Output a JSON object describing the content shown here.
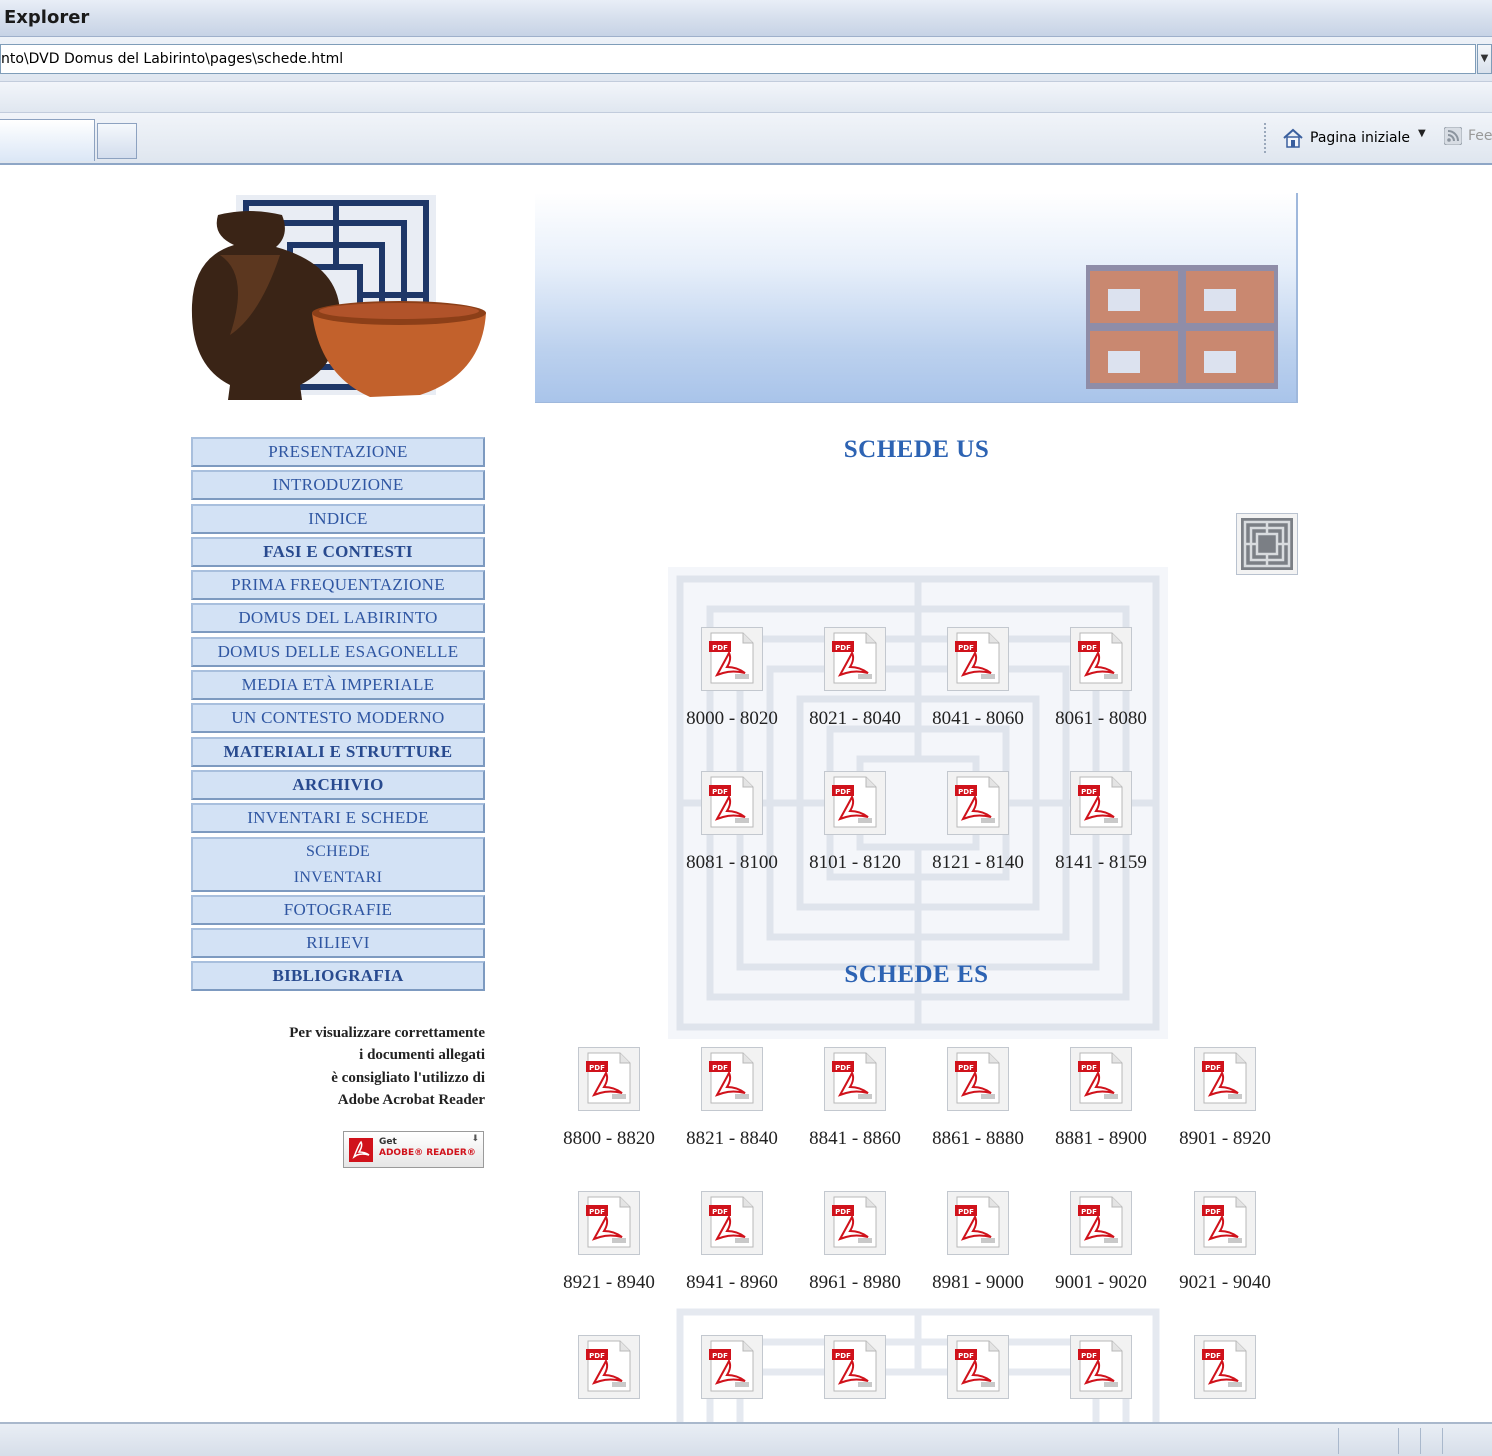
{
  "browser": {
    "title": "Explorer",
    "address": "nto\\DVD Domus del Labirinto\\pages\\schede.html",
    "home_label": "Pagina iniziale",
    "feed_label": "Fee"
  },
  "menu": [
    {
      "label": "PRESENTAZIONE",
      "style": "normal"
    },
    {
      "label": "INTRODUZIONE",
      "style": "normal"
    },
    {
      "label": "INDICE",
      "style": "normal"
    },
    {
      "label": "FASI E CONTESTI",
      "style": "bold"
    },
    {
      "label": "PRIMA FREQUENTAZIONE",
      "style": "normal"
    },
    {
      "label": "DOMUS DEL LABIRINTO",
      "style": "normal"
    },
    {
      "label": "DOMUS DELLE ESAGONELLE",
      "style": "normal"
    },
    {
      "label": "MEDIA ETÀ IMPERIALE",
      "style": "normal"
    },
    {
      "label": "UN CONTESTO MODERNO",
      "style": "normal"
    },
    {
      "label": "MATERIALI E STRUTTURE",
      "style": "bold"
    },
    {
      "label": "ARCHIVIO",
      "style": "bold"
    },
    {
      "label": "INVENTARI E SCHEDE",
      "style": "normal"
    },
    {
      "label": "SCHEDE\nINVENTARI",
      "style": "tall"
    },
    {
      "label": "FOTOGRAFIE",
      "style": "normal"
    },
    {
      "label": "RILIEVI",
      "style": "normal"
    },
    {
      "label": "BIBLIOGRAFIA",
      "style": "bold"
    }
  ],
  "note": {
    "line1": "Per visualizzare correttamente",
    "line2": "i documenti allegati",
    "line3": "è consigliato l'utilizzo di",
    "line4": "Adobe Acrobat Reader"
  },
  "adobe_badge": {
    "get": "Get",
    "text": "ADOBE® READER®"
  },
  "sections": {
    "us_title": "SCHEDE US",
    "es_title": "SCHEDE ES"
  },
  "us_files": [
    "8000 - 8020",
    "8021 - 8040",
    "8041 - 8060",
    "8061 - 8080",
    "8081 - 8100",
    "8101 - 8120",
    "8121 - 8140",
    "8141 - 8159"
  ],
  "es_files": [
    "8800 - 8820",
    "8821 - 8840",
    "8841 - 8860",
    "8861 - 8880",
    "8881 - 8900",
    "8901 - 8920",
    "8921 - 8940",
    "8941 - 8960",
    "8961 - 8980",
    "8981 - 9000",
    "9001 - 9020",
    "9021 - 9040"
  ],
  "es_files_partial_count": 6,
  "icons": {
    "pdf": "pdf-file-icon",
    "home": "home-icon",
    "feed": "rss-feed-icon",
    "maze": "labyrinth-icon"
  },
  "colors": {
    "menu_bg": "#d3e2f5",
    "menu_text": "#2f56a2",
    "heading": "#2d63b3",
    "pdf_red": "#d0121b"
  }
}
